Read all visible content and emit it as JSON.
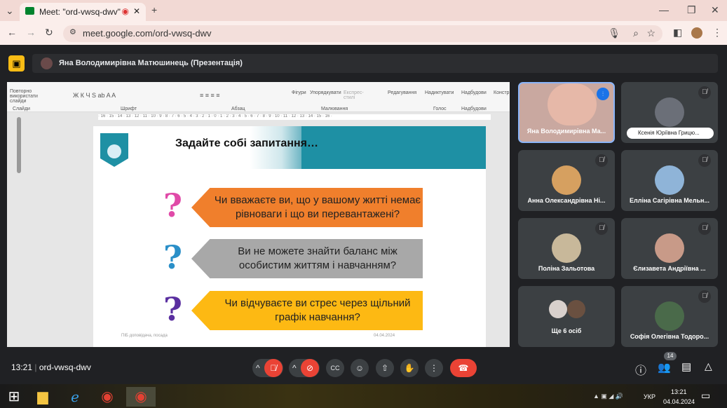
{
  "browser": {
    "tab_title": "Meet: \"ord-vwsq-dwv\"",
    "url": "meet.google.com/ord-vwsq-dwv"
  },
  "presenter": {
    "label": "Яна Володимирівна Матюшинець (Презентація)"
  },
  "ribbon": {
    "items": [
      "Повторно використати слайди",
      "Слайди",
      "Шрифт",
      "Абзац",
      "Фігури",
      "Упорядкувати",
      "Експрес-стилі",
      "Малювання",
      "Редагування",
      "Надиктувати",
      "Голос",
      "Надбудови",
      "Надбудови",
      "Констр"
    ]
  },
  "ruler": "· 16 · 15 · 14 · 13 · 12 · 11 · 10 · 9 · 8 · 7 · 6 · 5 · 4 · 3 · 2 · 1 · 0 · 1 · 2 · 3 · 4 · 5 · 6 · 7 · 8 · 9 · 10 · 11 · 12 · 13 · 14 · 15 · 16 ·",
  "slide": {
    "title": "Задайте собі запитання…",
    "questions": [
      {
        "text": "Чи вважаєте ви, що у вашому житті немає рівноваги і що ви перевантажені?",
        "color": "#f07f2c",
        "mark_color": "#e04aa8"
      },
      {
        "text": "Ви не можете знайти баланс між особистим життям і навчанням?",
        "color": "#a8a8a8",
        "mark_color": "#2a8fc8"
      },
      {
        "text": "Чи відчуваєте ви стрес через щільний графік навчання?",
        "color": "#fdb913",
        "mark_color": "#5a2fa0"
      }
    ],
    "footer_left": "ПІБ доповідача, посада",
    "footer_date": "04.04.2024"
  },
  "participants": [
    {
      "name": "Яна Володимирівна Ма...",
      "speaking": true
    },
    {
      "name": "Ксенія Юріївна Грицю...",
      "muted": true
    },
    {
      "name": "Анна Олександрівна Ні...",
      "muted": true
    },
    {
      "name": "Елліна Сагірівна Мельн...",
      "muted": true
    },
    {
      "name": "Поліна Зальотова",
      "muted": true
    },
    {
      "name": "Єлизавета Андріївна ...",
      "muted": true
    },
    {
      "name": "Ще 6 осіб"
    },
    {
      "name": "Софія Олегівна Тодоро...",
      "muted": true
    }
  ],
  "bottom": {
    "time": "13:21",
    "meeting_code": "ord-vwsq-dwv",
    "participant_count": "14"
  },
  "taskbar": {
    "lang": "УКР",
    "time": "13:21",
    "date": "04.04.2024"
  }
}
